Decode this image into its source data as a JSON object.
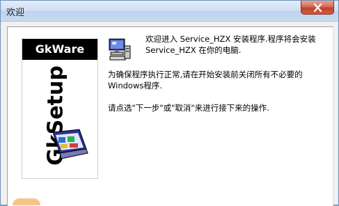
{
  "window": {
    "title": "欢迎"
  },
  "banner": {
    "brand": "GkWare",
    "vertical_brand": "GkSetup"
  },
  "content": {
    "intro_line1": "欢迎进入 Service_HZX 安装程序.程序将会安装",
    "intro_line2": "Service_HZX 在你的电脑.",
    "warning_line1": "为确保程序执行正常,请在开始安装前关闭所有不必要的",
    "warning_line2": "Windows程序.",
    "instruction": "请点选\"下一步\"或\"取消\"来进行接下来的操作."
  },
  "colors": {
    "close_button": "#c2412a",
    "titlebar": "#cfdff2",
    "brand_bar": "#000000"
  },
  "icons": {
    "close": "close-icon",
    "computer": "computer-icon",
    "setup_graphic": "setup-graphic-icon"
  }
}
